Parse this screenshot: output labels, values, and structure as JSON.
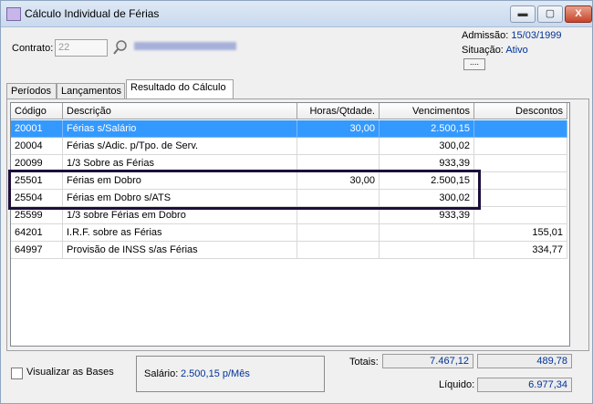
{
  "window": {
    "title": "Cálculo Individual de Férias",
    "btn_min": "▬",
    "btn_max": "▢",
    "btn_close": "X"
  },
  "header": {
    "contrato_label": "Contrato:",
    "contrato_value": "22",
    "admissao_label": "Admissão:",
    "admissao_value": "15/03/1999",
    "situacao_label": "Situação:",
    "situacao_value": "Ativo",
    "more_button": "...."
  },
  "tabs": [
    {
      "label": "Períodos"
    },
    {
      "label": "Lançamentos"
    },
    {
      "label": "Resultado do Cálculo"
    }
  ],
  "table": {
    "columns": [
      "Código",
      "Descrição",
      "Horas/Qtdade.",
      "Vencimentos",
      "Descontos"
    ],
    "rows": [
      {
        "codigo": "20001",
        "descricao": "Férias s/Salário",
        "horas": "30,00",
        "vencimentos": "2.500,15",
        "descontos": ""
      },
      {
        "codigo": "20004",
        "descricao": "Férias s/Adic. p/Tpo. de Serv.",
        "horas": "",
        "vencimentos": "300,02",
        "descontos": ""
      },
      {
        "codigo": "20099",
        "descricao": "1/3 Sobre as Férias",
        "horas": "",
        "vencimentos": "933,39",
        "descontos": ""
      },
      {
        "codigo": "25501",
        "descricao": "Férias em Dobro",
        "horas": "30,00",
        "vencimentos": "2.500,15",
        "descontos": ""
      },
      {
        "codigo": "25504",
        "descricao": "Férias em Dobro s/ATS",
        "horas": "",
        "vencimentos": "300,02",
        "descontos": ""
      },
      {
        "codigo": "25599",
        "descricao": "1/3 sobre Férias em Dobro",
        "horas": "",
        "vencimentos": "933,39",
        "descontos": ""
      },
      {
        "codigo": "64201",
        "descricao": "I.R.F. sobre as Férias",
        "horas": "",
        "vencimentos": "",
        "descontos": "155,01"
      },
      {
        "codigo": "64997",
        "descricao": "Provisão de INSS s/as Férias",
        "horas": "",
        "vencimentos": "",
        "descontos": "334,77"
      }
    ]
  },
  "footer": {
    "visualizar_label": "Visualizar as Bases",
    "salario_label": "Salário:",
    "salario_value": "2.500,15 p/Mês",
    "totais_label": "Totais:",
    "totais_vencimentos": "7.467,12",
    "totais_descontos": "489,78",
    "liquido_label": "Líquido:",
    "liquido_value": "6.977,34"
  },
  "colors": {
    "selection": "#3399ff",
    "value_text": "#003399",
    "highlight_border": "#1c0f3a"
  }
}
